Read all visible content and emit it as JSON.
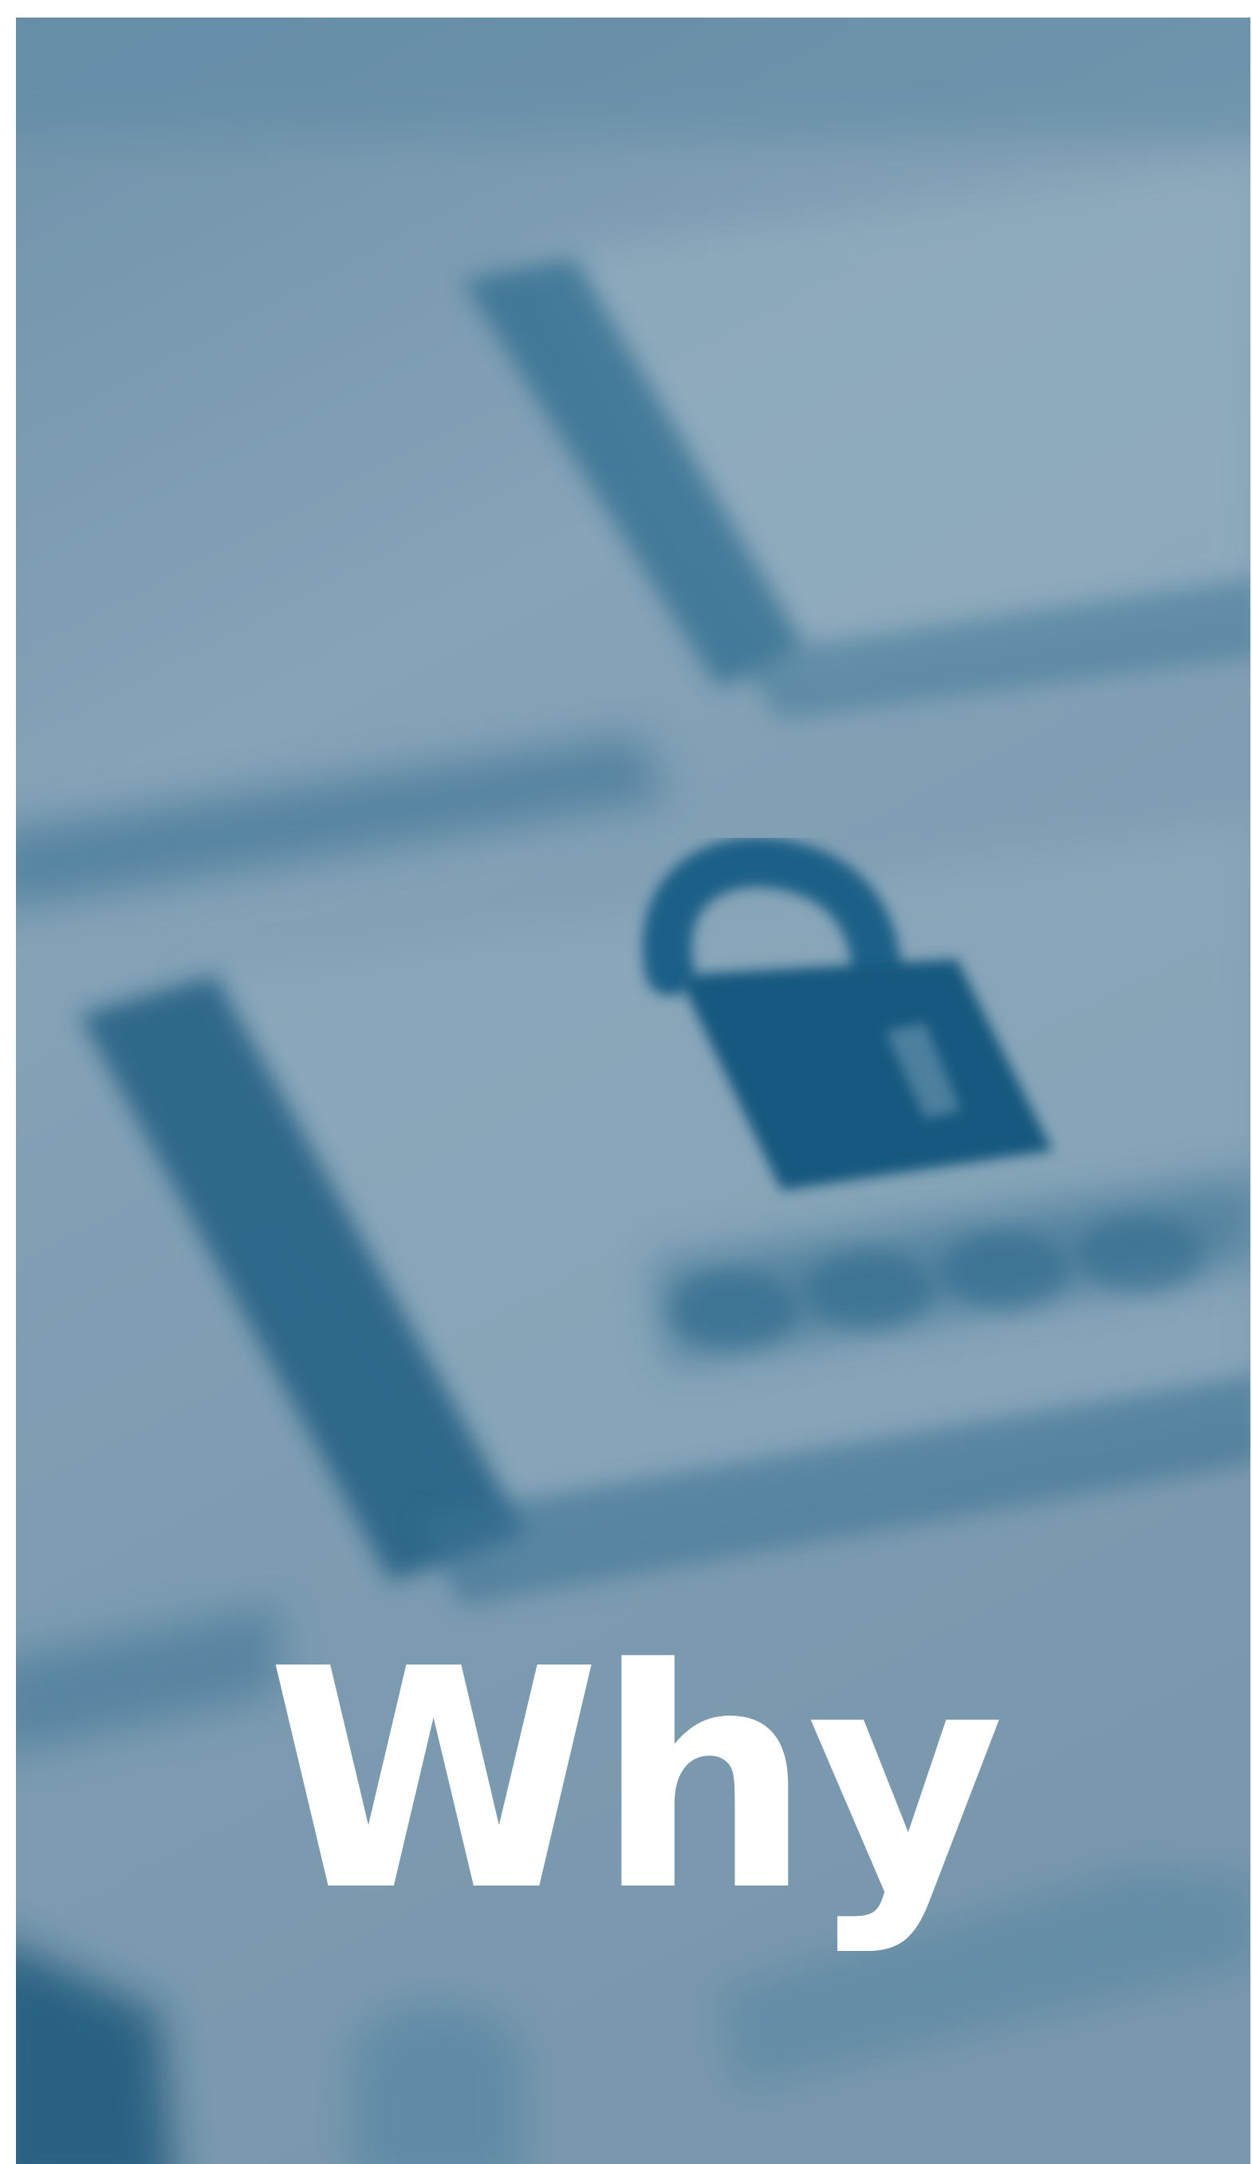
{
  "headline": "Why",
  "photo": {
    "subject": "padlock-key-icon",
    "key_label": "",
    "tint_color": "#7f9db2",
    "shadow_color": "#1f5f84",
    "icon_color": "#13597f"
  }
}
